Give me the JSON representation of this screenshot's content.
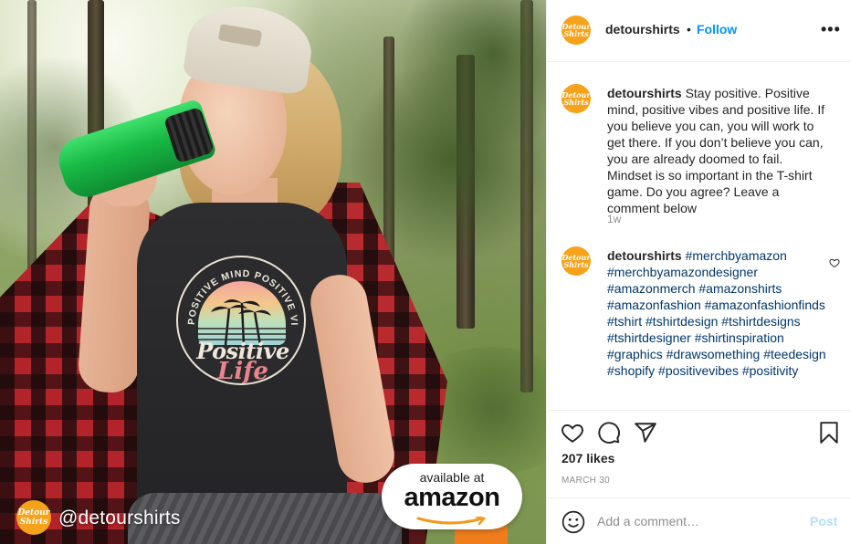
{
  "photo": {
    "watermark_logo": "Detour Shirts",
    "watermark_handle": "@detourshirts",
    "badge_small": "available at",
    "badge_big": "amazon",
    "shirt_print": {
      "arc_text": "POSITIVE MIND POSITIVE VIBES",
      "word1": "Positive",
      "word2": "Life"
    }
  },
  "header": {
    "avatar_text": "Detour Shirts",
    "username": "detourshirts",
    "separator": "•",
    "follow_label": "Follow",
    "more_label": "•••"
  },
  "caption": {
    "avatar_text": "Detour Shirts",
    "username": "detourshirts",
    "text": " Stay positive. Positive mind, positive vibes and positive life. If you believe you can, you will work to get there. If you don’t believe you can, you are already doomed to fail. Mindset is so important in the T-shirt game. Do you agree? Leave a comment below",
    "time": "1w"
  },
  "comment": {
    "avatar_text": "Detour Shirts",
    "username": "detourshirts",
    "hashtags": "#merchbyamazon #merchbyamazondesigner #amazonmerch #amazonshirts #amazonfashion #amazonfashionfinds #tshirt #tshirtdesign #tshirtdesigns #tshirtdesigner #shirtinspiration #graphics #drawsomething #teedesign #shopify #positivevibes #positivity"
  },
  "actions": {
    "icons": [
      "heart-icon",
      "comment-icon",
      "share-icon",
      "bookmark-icon"
    ],
    "likes": "207 likes",
    "date": "MARCH 30"
  },
  "add_comment": {
    "placeholder": "Add a comment…",
    "post_label": "Post"
  },
  "colors": {
    "link_blue": "#0095f6",
    "brand_orange": "#f7a21b",
    "hashtag": "#00376b",
    "muted": "#8e8e8e"
  }
}
